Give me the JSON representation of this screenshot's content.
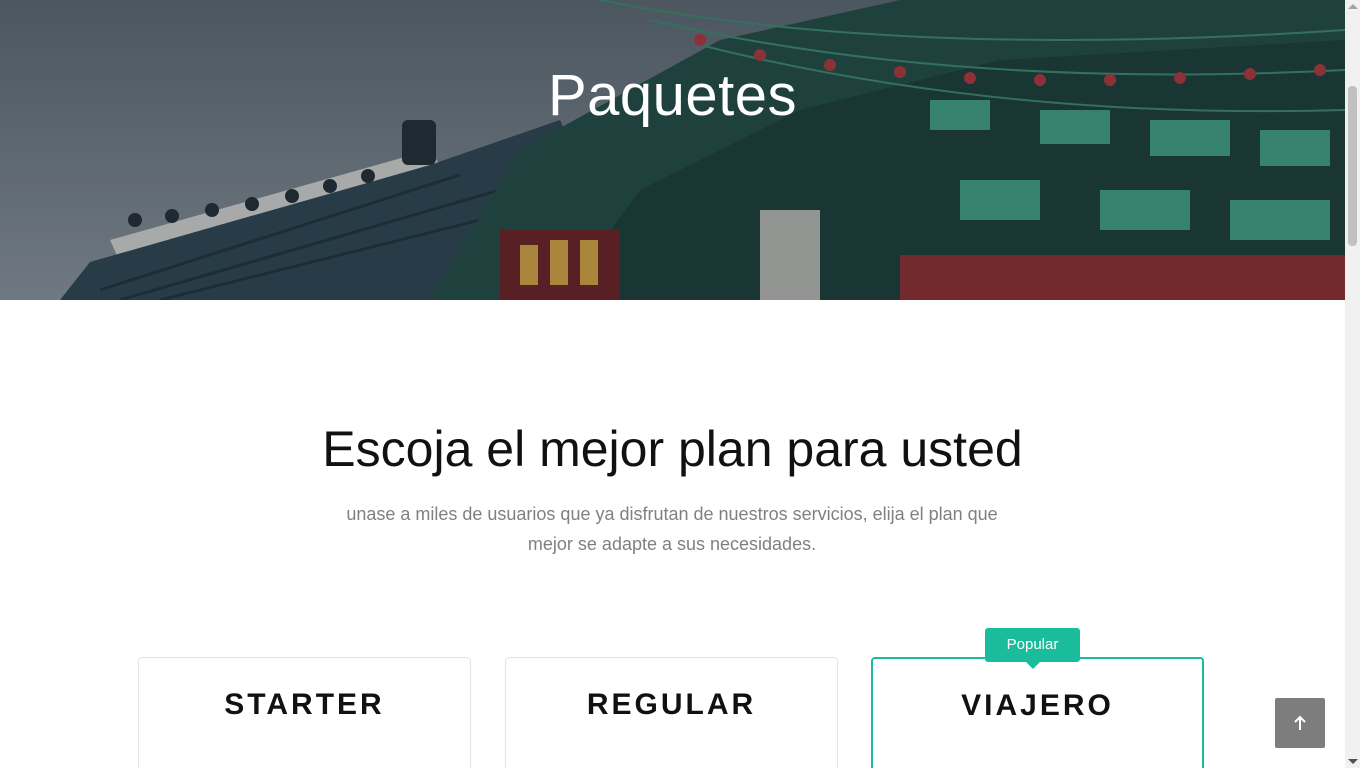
{
  "hero": {
    "title": "Paquetes"
  },
  "section": {
    "title": "Escoja el mejor plan para usted",
    "subtitle": "unase a miles de usuarios que ya disfrutan de nuestros servicios, elija el plan que mejor se adapte a sus necesidades."
  },
  "plans": [
    {
      "name": "STARTER"
    },
    {
      "name": "REGULAR"
    },
    {
      "name": "VIAJERO",
      "badge": "Popular"
    }
  ],
  "colors": {
    "accent": "#1abc9c",
    "back_to_top_bg": "#7d7d7d"
  },
  "icons": {
    "back_to_top": "arrow-up-icon"
  }
}
